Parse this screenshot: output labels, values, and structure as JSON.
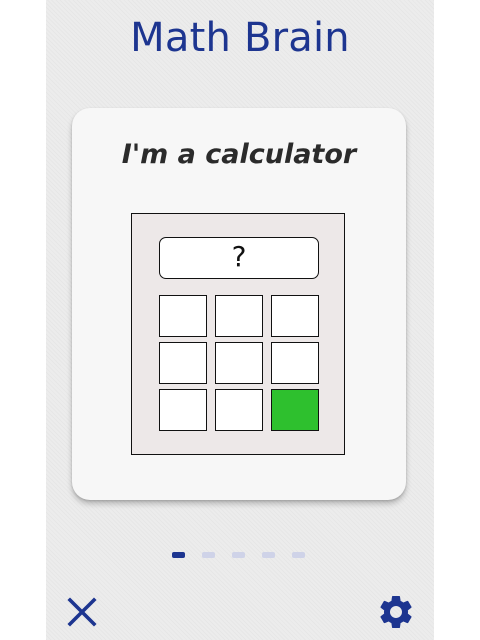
{
  "app": {
    "title": "Math Brain"
  },
  "card": {
    "title": "I'm a calculator",
    "calculator": {
      "display": "?",
      "rows": 3,
      "cols": 3,
      "highlighted_key": 8,
      "highlight_color": "#2ec02e"
    }
  },
  "pager": {
    "total": 5,
    "active_index": 0,
    "active_color": "#1d3590",
    "inactive_color": "#cfd3e8"
  },
  "footer": {
    "close_icon": "close-icon",
    "settings_icon": "gear-icon"
  },
  "colors": {
    "accent": "#1d3590",
    "background": "#ececec",
    "card": "#f7f7f7"
  }
}
